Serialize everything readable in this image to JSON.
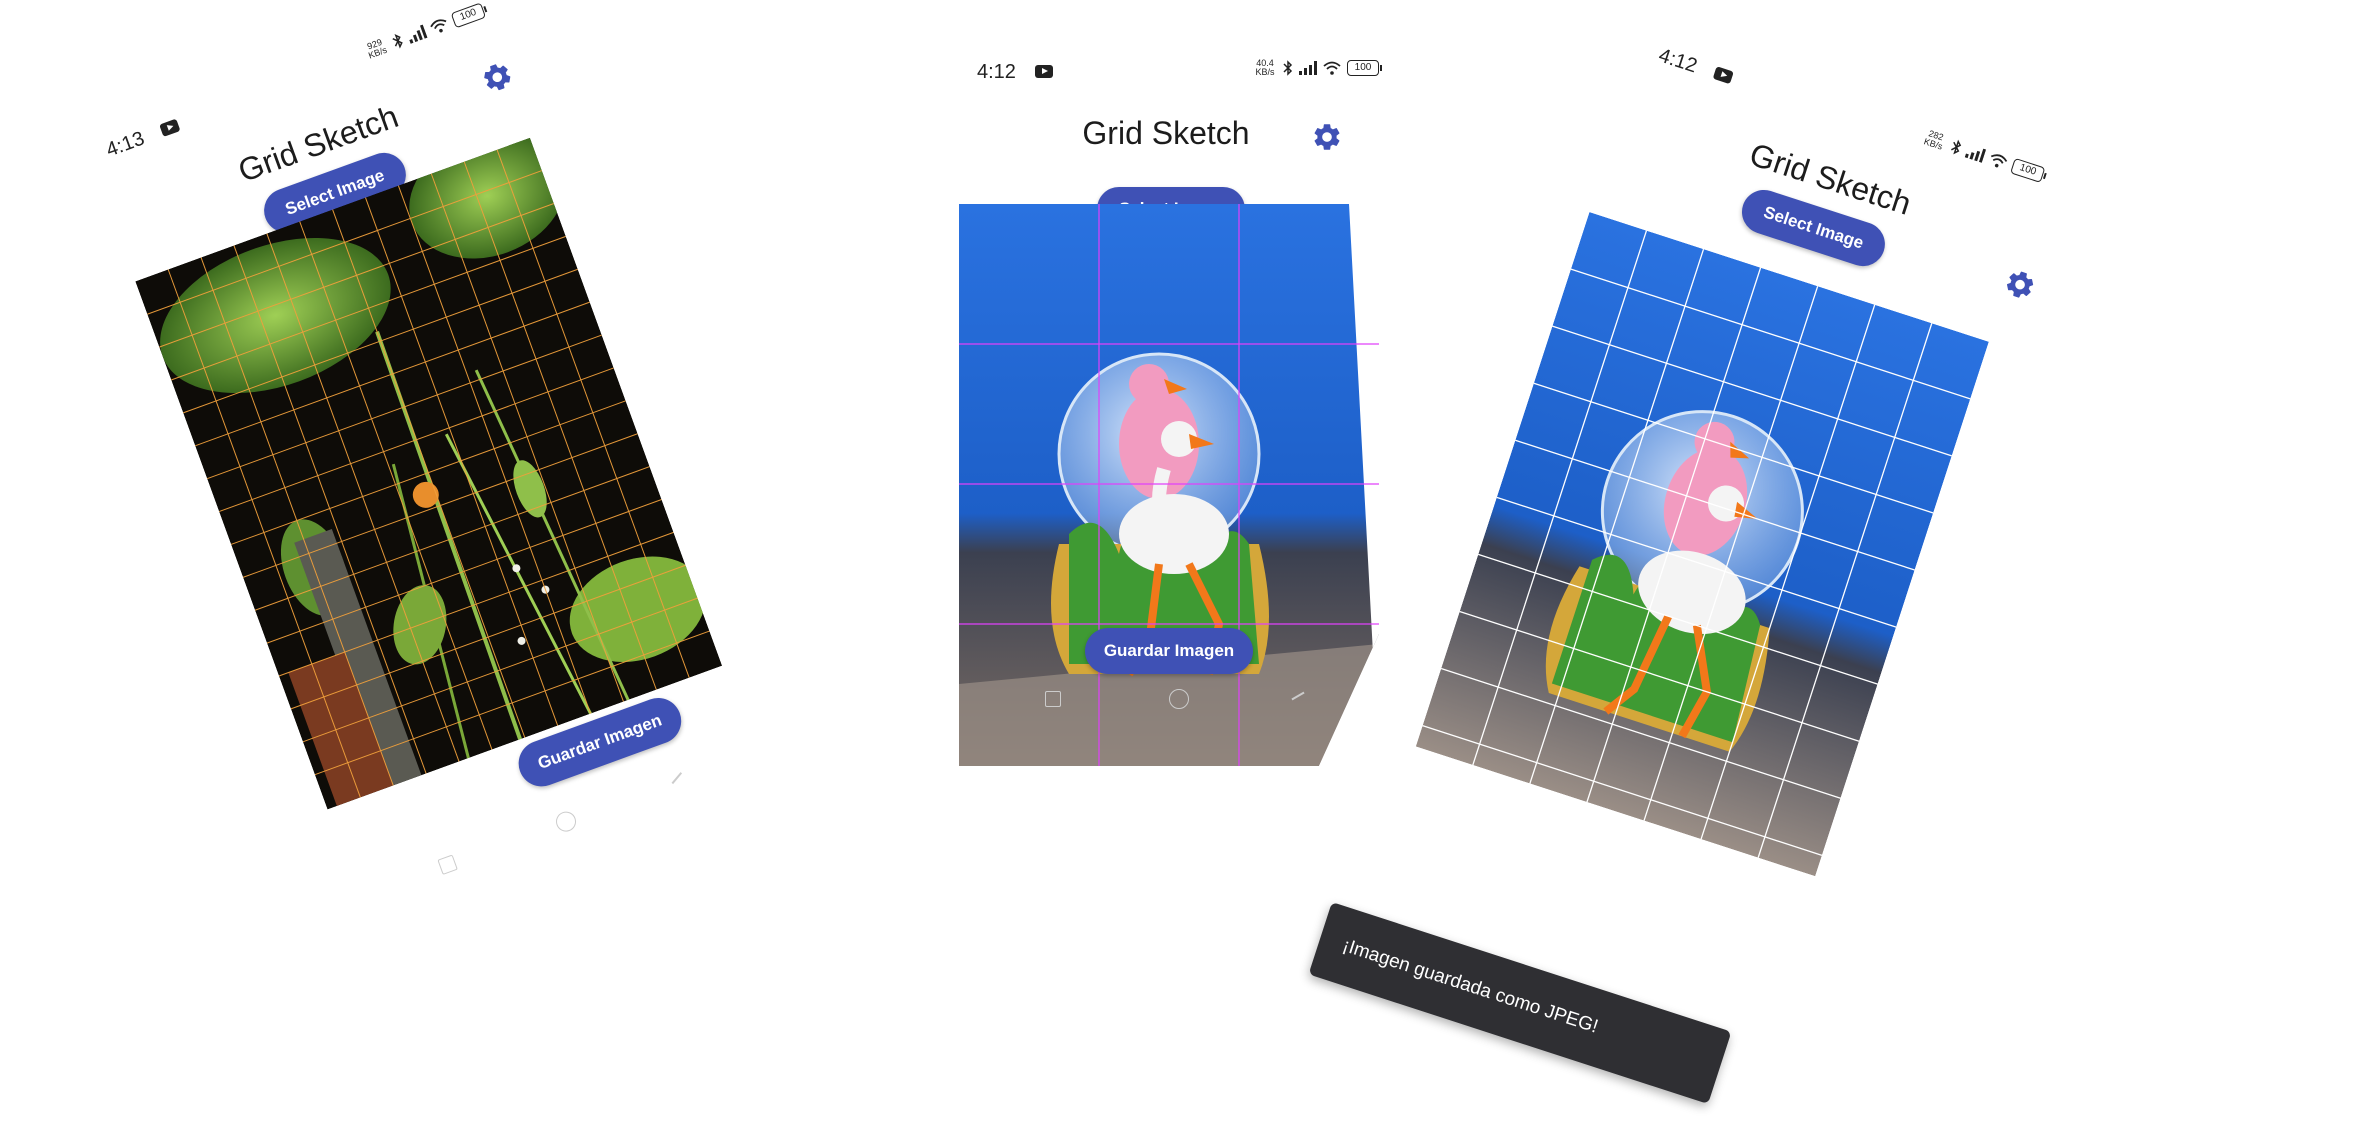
{
  "screens": [
    {
      "status": {
        "time": "4:13",
        "net_speed": "929\nKB/s",
        "battery": "100"
      },
      "title": "Grid Sketch",
      "select_button": "Select Image",
      "save_button": "Guardar Imagen",
      "grid_color": "#f0a03c",
      "photo": "plant-stem-with-orange-berry"
    },
    {
      "status": {
        "time": "4:12",
        "net_speed": "40.4\nKB/s",
        "battery": "100"
      },
      "title": "Grid Sketch",
      "select_button": "Select Image",
      "save_button": "Guardar Imagen",
      "grid_color": "#e040fb",
      "photo": "flamingo-snow-globe"
    },
    {
      "status": {
        "time": "4:12",
        "net_speed": "282\nKB/s",
        "battery": "100"
      },
      "title": "Grid Sketch",
      "select_button": "Select Image",
      "grid_color": "#ffffff",
      "photo": "flamingo-snow-globe"
    }
  ],
  "toast": {
    "message": "¡Imagen guardada como JPEG!"
  },
  "colors": {
    "accent": "#3f51b5",
    "toast_background": "#2f2f33",
    "sky_blue": "#1d5fc8"
  },
  "icons": {
    "settings": "gear-icon",
    "youtube": "youtube-notification-icon",
    "bluetooth": "bluetooth-icon",
    "signal": "signal-icon",
    "wifi": "wifi-icon",
    "battery": "battery-icon"
  }
}
